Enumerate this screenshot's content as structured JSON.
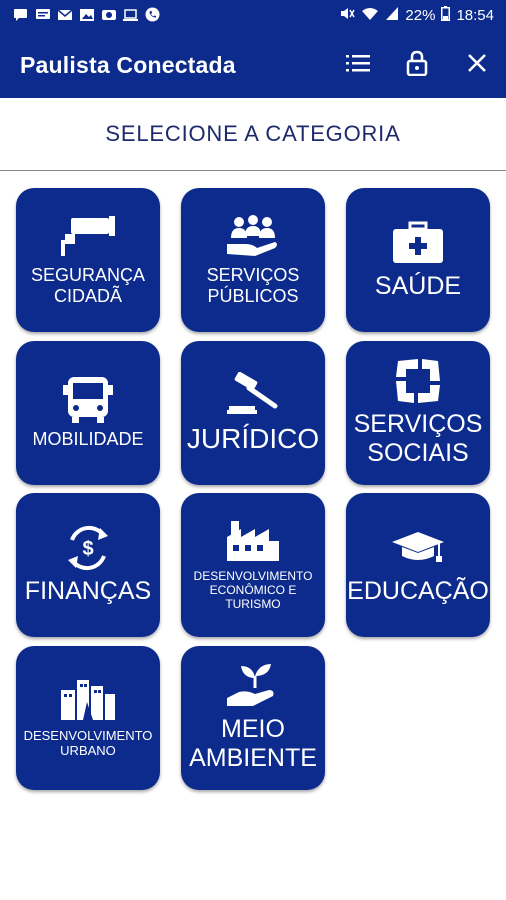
{
  "status_bar": {
    "battery": "22%",
    "time": "18:54"
  },
  "app_bar": {
    "title": "Paulista Conectada",
    "actions": [
      "list-icon",
      "lock-icon",
      "close-icon"
    ]
  },
  "header": {
    "title": "SELECIONE A CATEGORIA"
  },
  "categories": [
    {
      "label": "SEGURANÇA\nCIDADÃ",
      "icon": "security-camera-icon"
    },
    {
      "label": "SERVIÇOS\nPÚBLICOS",
      "icon": "people-hand-icon"
    },
    {
      "label": "SAÚDE",
      "icon": "first-aid-kit-icon"
    },
    {
      "label": "MOBILIDADE",
      "icon": "bus-icon"
    },
    {
      "label": "JURÍDICO",
      "icon": "gavel-icon"
    },
    {
      "label": "SERVIÇOS\nSOCIAIS",
      "icon": "hands-circle-icon"
    },
    {
      "label": "FINANÇAS",
      "icon": "money-cycle-icon"
    },
    {
      "label": "DESENVOLVIMENTO\nECONÔMICO E\nTURISMO",
      "icon": "factory-icon"
    },
    {
      "label": "EDUCAÇÃO",
      "icon": "graduation-cap-icon"
    },
    {
      "label": "DESENVOLVIMENTO\nURBANO",
      "icon": "city-buildings-icon"
    },
    {
      "label": "MEIO\nAMBIENTE",
      "icon": "plant-hand-icon"
    }
  ],
  "colors": {
    "primary": "#0d2b8c",
    "header_text": "#1d2a6b",
    "background": "#ffffff"
  }
}
